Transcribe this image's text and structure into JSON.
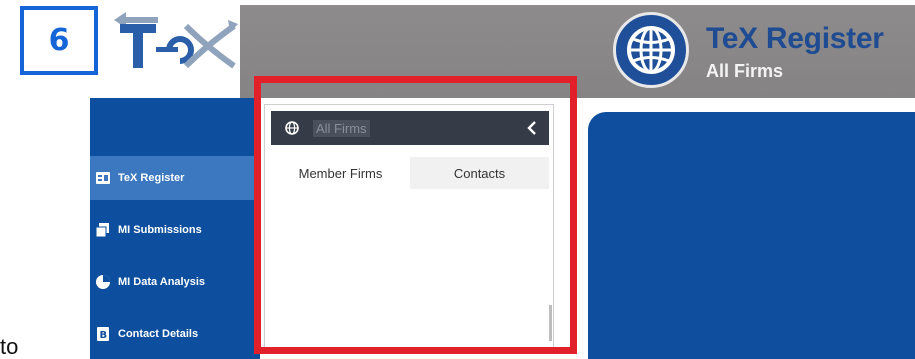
{
  "step_badge": {
    "number": "6",
    "color": "#1565d8"
  },
  "logo": {
    "icon": "tex-logo",
    "text": "TeX"
  },
  "header": {
    "title": "TeX Register",
    "subtitle": "All Firms",
    "icon": "globe-icon"
  },
  "sidebar": {
    "items": [
      {
        "label": "TeX Register",
        "icon": "register-icon",
        "active": true
      },
      {
        "label": "MI Submissions",
        "icon": "submissions-icon",
        "active": false
      },
      {
        "label": "MI Data Analysis",
        "icon": "analysis-icon",
        "active": false
      },
      {
        "label": "Contact Details",
        "icon": "contact-icon",
        "active": false
      }
    ]
  },
  "flyout": {
    "title": "All Firms",
    "title_icon": "globe-icon",
    "collapse_icon": "chevron-left-icon",
    "tabs": [
      {
        "label": "Member Firms",
        "active": true
      },
      {
        "label": "Contacts",
        "active": false
      }
    ]
  },
  "colors": {
    "highlight": "#e2202a",
    "sidebar": "#0d4f9e",
    "header": "#858383",
    "accent_blue": "#1e4b92"
  },
  "stray_text": "to"
}
